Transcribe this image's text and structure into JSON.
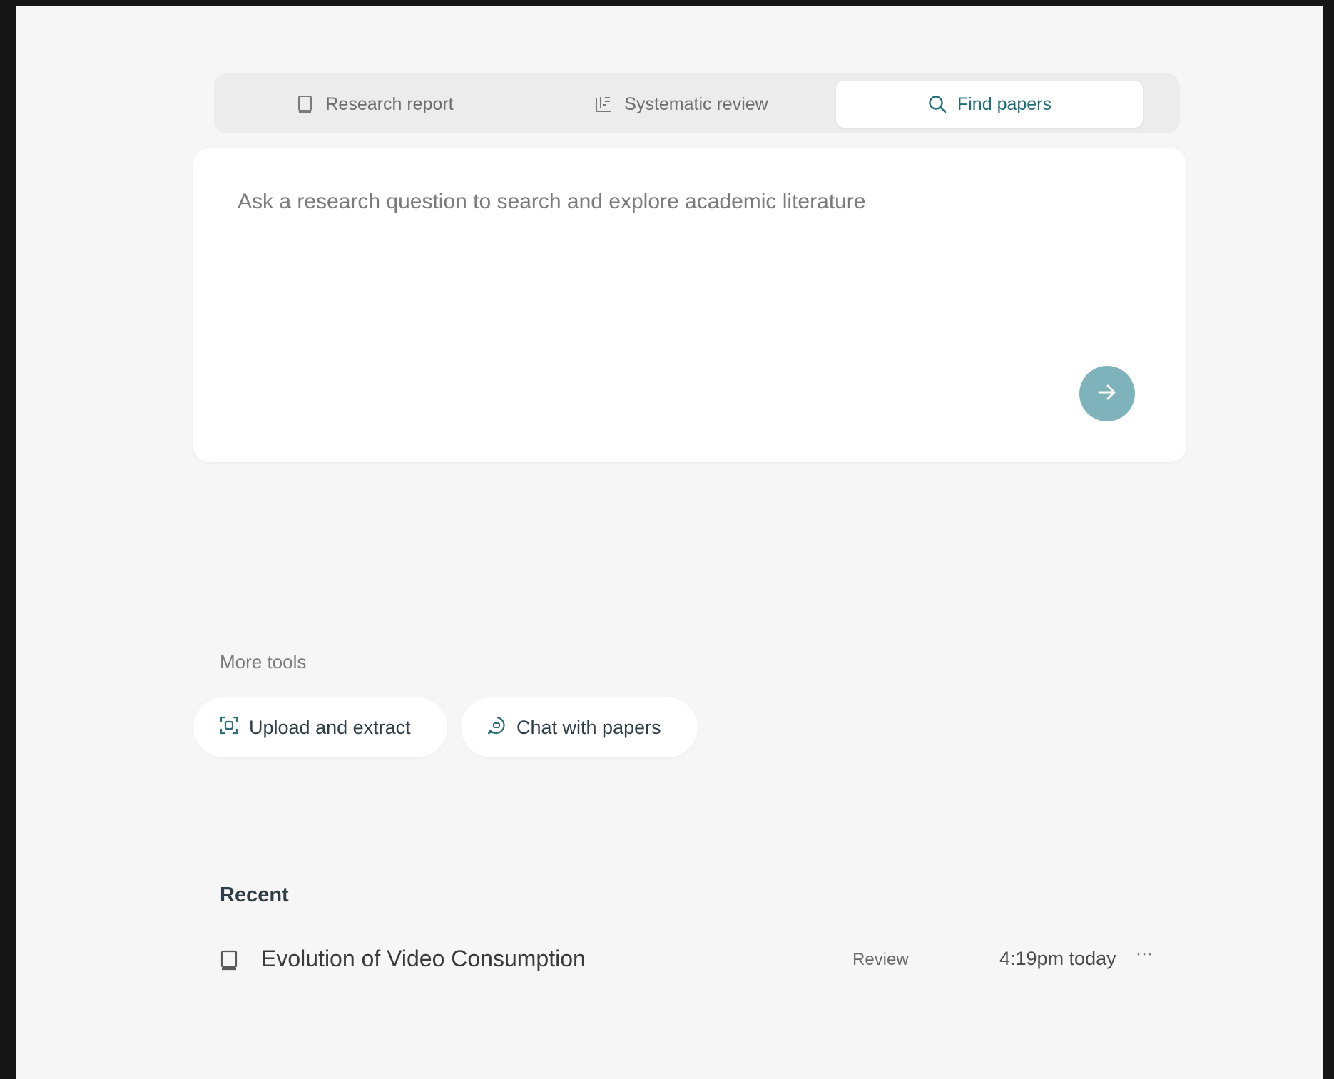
{
  "mode_tabs": [
    {
      "label": "Research report",
      "icon": "notebook-icon",
      "active": false
    },
    {
      "label": "Systematic review",
      "icon": "list-review-icon",
      "active": false
    },
    {
      "label": "Find papers",
      "icon": "search-icon",
      "active": true
    }
  ],
  "query": {
    "placeholder": "Ask a research question to search and explore academic literature",
    "value": "",
    "submit_icon": "arrow-right-icon"
  },
  "more_tools": {
    "label": "More tools",
    "items": [
      {
        "label": "Upload and extract",
        "icon": "extract-icon"
      },
      {
        "label": "Chat with papers",
        "icon": "chat-icon"
      }
    ]
  },
  "recent": {
    "title": "Recent",
    "items": [
      {
        "title": "Evolution of Video Consumption",
        "type": "Review",
        "time": "4:19pm today",
        "icon": "notebook-icon",
        "more": "···"
      }
    ]
  },
  "colors": {
    "accent": "#1f6e78",
    "submit_bg": "#7fb3bb",
    "page_bg": "#f6f6f6",
    "frame_bg": "#161616"
  }
}
